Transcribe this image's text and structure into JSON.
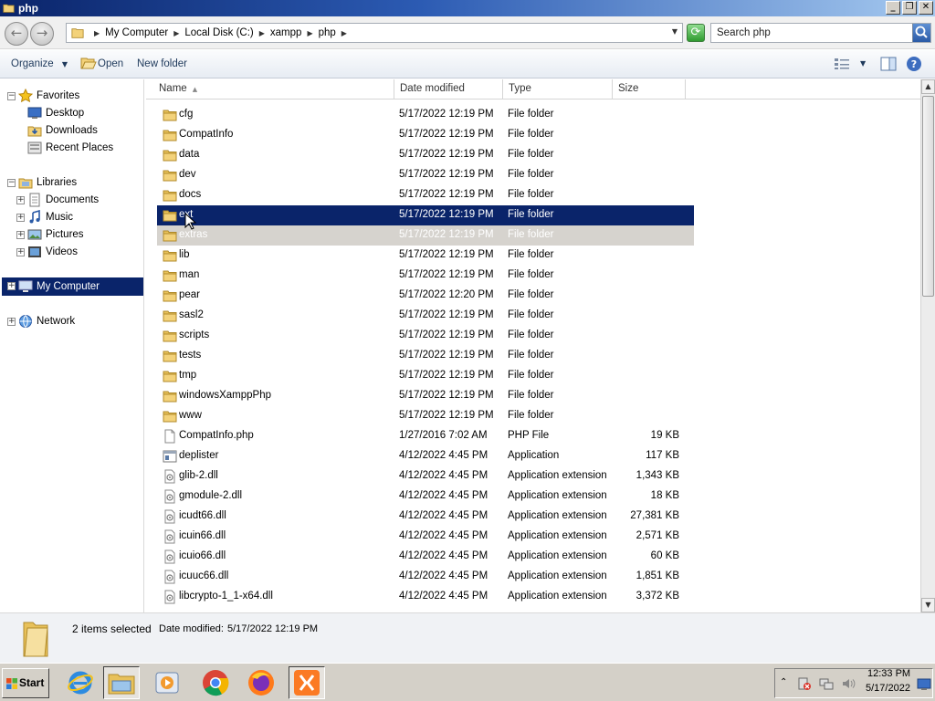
{
  "window": {
    "title": "php"
  },
  "address": {
    "crumbs": [
      "My Computer",
      "Local Disk (C:)",
      "xampp",
      "php"
    ],
    "search_placeholder": "Search php"
  },
  "toolbar": {
    "organize": "Organize",
    "open": "Open",
    "new_folder": "New folder"
  },
  "nav": {
    "favorites": "Favorites",
    "desktop": "Desktop",
    "downloads": "Downloads",
    "recent": "Recent Places",
    "libraries": "Libraries",
    "documents": "Documents",
    "music": "Music",
    "pictures": "Pictures",
    "videos": "Videos",
    "computer": "My Computer",
    "network": "Network"
  },
  "columns": {
    "name": "Name",
    "date": "Date modified",
    "type": "Type",
    "size": "Size"
  },
  "files": [
    {
      "name": "cfg",
      "date": "5/17/2022 12:19 PM",
      "type": "File folder",
      "size": "",
      "icon": "folder-icon"
    },
    {
      "name": "CompatInfo",
      "date": "5/17/2022 12:19 PM",
      "type": "File folder",
      "size": "",
      "icon": "folder-icon"
    },
    {
      "name": "data",
      "date": "5/17/2022 12:19 PM",
      "type": "File folder",
      "size": "",
      "icon": "folder-icon"
    },
    {
      "name": "dev",
      "date": "5/17/2022 12:19 PM",
      "type": "File folder",
      "size": "",
      "icon": "folder-icon"
    },
    {
      "name": "docs",
      "date": "5/17/2022 12:19 PM",
      "type": "File folder",
      "size": "",
      "icon": "folder-icon"
    },
    {
      "name": "ext",
      "date": "5/17/2022 12:19 PM",
      "type": "File folder",
      "size": "",
      "icon": "folder-icon"
    },
    {
      "name": "extras",
      "date": "5/17/2022 12:19 PM",
      "type": "File folder",
      "size": "",
      "icon": "folder-icon"
    },
    {
      "name": "lib",
      "date": "5/17/2022 12:19 PM",
      "type": "File folder",
      "size": "",
      "icon": "folder-icon"
    },
    {
      "name": "man",
      "date": "5/17/2022 12:19 PM",
      "type": "File folder",
      "size": "",
      "icon": "folder-icon"
    },
    {
      "name": "pear",
      "date": "5/17/2022 12:20 PM",
      "type": "File folder",
      "size": "",
      "icon": "folder-icon"
    },
    {
      "name": "sasl2",
      "date": "5/17/2022 12:19 PM",
      "type": "File folder",
      "size": "",
      "icon": "folder-icon"
    },
    {
      "name": "scripts",
      "date": "5/17/2022 12:19 PM",
      "type": "File folder",
      "size": "",
      "icon": "folder-icon"
    },
    {
      "name": "tests",
      "date": "5/17/2022 12:19 PM",
      "type": "File folder",
      "size": "",
      "icon": "folder-icon"
    },
    {
      "name": "tmp",
      "date": "5/17/2022 12:19 PM",
      "type": "File folder",
      "size": "",
      "icon": "folder-icon"
    },
    {
      "name": "windowsXamppPhp",
      "date": "5/17/2022 12:19 PM",
      "type": "File folder",
      "size": "",
      "icon": "folder-icon"
    },
    {
      "name": "www",
      "date": "5/17/2022 12:19 PM",
      "type": "File folder",
      "size": "",
      "icon": "folder-icon"
    },
    {
      "name": "CompatInfo.php",
      "date": "1/27/2016 7:02 AM",
      "type": "PHP File",
      "size": "19 KB",
      "icon": "file-icon"
    },
    {
      "name": "deplister",
      "date": "4/12/2022 4:45 PM",
      "type": "Application",
      "size": "117 KB",
      "icon": "application-icon"
    },
    {
      "name": "glib-2.dll",
      "date": "4/12/2022 4:45 PM",
      "type": "Application extension",
      "size": "1,343 KB",
      "icon": "dll-icon"
    },
    {
      "name": "gmodule-2.dll",
      "date": "4/12/2022 4:45 PM",
      "type": "Application extension",
      "size": "18 KB",
      "icon": "dll-icon"
    },
    {
      "name": "icudt66.dll",
      "date": "4/12/2022 4:45 PM",
      "type": "Application extension",
      "size": "27,381 KB",
      "icon": "dll-icon"
    },
    {
      "name": "icuin66.dll",
      "date": "4/12/2022 4:45 PM",
      "type": "Application extension",
      "size": "2,571 KB",
      "icon": "dll-icon"
    },
    {
      "name": "icuio66.dll",
      "date": "4/12/2022 4:45 PM",
      "type": "Application extension",
      "size": "60 KB",
      "icon": "dll-icon"
    },
    {
      "name": "icuuc66.dll",
      "date": "4/12/2022 4:45 PM",
      "type": "Application extension",
      "size": "1,851 KB",
      "icon": "dll-icon"
    },
    {
      "name": "libcrypto-1_1-x64.dll",
      "date": "4/12/2022 4:45 PM",
      "type": "Application extension",
      "size": "3,372 KB",
      "icon": "dll-icon"
    }
  ],
  "selection": {
    "primary": "ext",
    "secondary": "extras"
  },
  "details": {
    "summary": "2 items selected",
    "date_label": "Date modified:",
    "date_value": "5/17/2022 12:19 PM"
  },
  "taskbar": {
    "start": "Start",
    "time": "12:33 PM",
    "date": "5/17/2022"
  },
  "colors": {
    "selection": "#0a246a",
    "secondary_selection": "#d6d3ce",
    "folder": "#e8c15a"
  }
}
